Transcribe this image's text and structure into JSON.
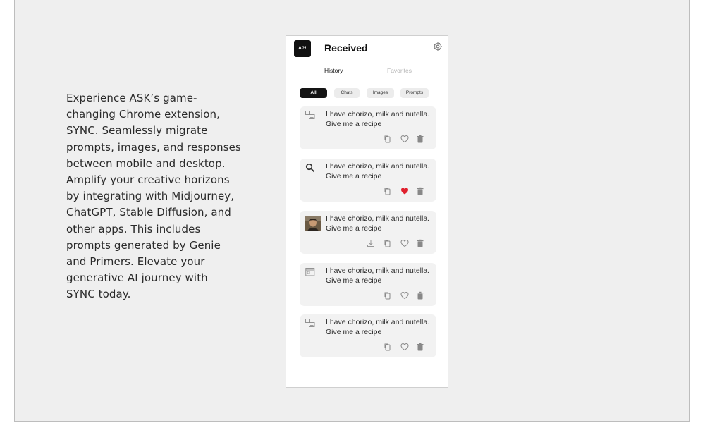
{
  "description": "Experience ASK’s game-\nchanging Chrome extension,\nSYNC. Seamlessly migrate\nprompts, images, and responses\nbetween mobile and desktop.\nAmplify your creative horizons\nby integrating with Midjourney,\nChatGPT, Stable Diffusion, and\nother apps. This includes\nprompts generated by Genie\nand Primers. Elevate your\ngenerative AI journey with\nSYNC today.",
  "app": {
    "logo_text": "A?!",
    "title": "Received",
    "settings_icon": "gear-icon",
    "tabs": {
      "history": "History",
      "favorites": "Favorites"
    },
    "filters": {
      "all": "All",
      "chats": "Chats",
      "images": "Images",
      "prompts": "Prompts"
    },
    "cards": [
      {
        "text": "I have chorizo, milk and nutella. Give me a recipe",
        "icon": "chat-icon",
        "favorited": false
      },
      {
        "text": "I have chorizo, milk and nutella. Give me a recipe",
        "icon": "search-icon",
        "favorited": true
      },
      {
        "text": "I have chorizo, milk and nutella. Give me a recipe",
        "icon": "image-thumbnail",
        "favorited": false,
        "download": true
      },
      {
        "text": "I have chorizo, milk and nutella. Give me a recipe",
        "icon": "prompt-icon",
        "favorited": false
      },
      {
        "text": "I have chorizo, milk and nutella. Give me a recipe",
        "icon": "chat-icon",
        "favorited": false
      }
    ],
    "colors": {
      "accent_black": "#141414",
      "favorite_red": "#e0212e"
    }
  }
}
